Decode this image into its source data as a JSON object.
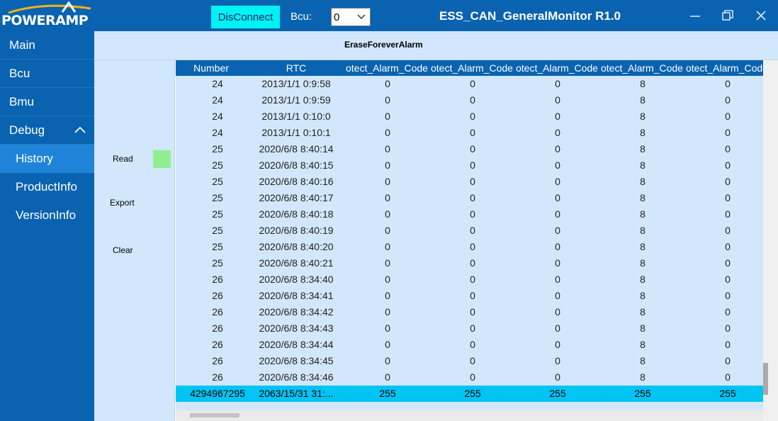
{
  "titlebar": {
    "logo": "POWERAMP",
    "disconnect_label": "DisConnect",
    "bcu_label": "Bcu:",
    "bcu_value": "0",
    "title": "ESS_CAN_GeneralMonitor R1.0"
  },
  "sidebar": {
    "items": [
      {
        "label": "Main"
      },
      {
        "label": "Bcu"
      },
      {
        "label": "Bmu"
      },
      {
        "label": "Debug"
      },
      {
        "label": "History"
      },
      {
        "label": "ProductInfo"
      },
      {
        "label": "VersionInfo"
      }
    ]
  },
  "header": {
    "erase_label": "EraseForeverAlarm"
  },
  "controls": {
    "read": "Read",
    "export": "Export",
    "clear": "Clear"
  },
  "colors": {
    "brand_blue": "#0a63b0",
    "panel": "#d2e7fb",
    "accent_cyan": "#00f2f2",
    "selected_row": "#00c4f4",
    "led_green": "#90ee90"
  },
  "table": {
    "columns": [
      "Number",
      "RTC",
      "otect_Alarm_Code",
      "otect_Alarm_Code",
      "otect_Alarm_Code",
      "otect_Alarm_Code",
      "otect_Alarm_Code"
    ],
    "rows": [
      [
        "24",
        "2013/1/1 0:9:58",
        "0",
        "0",
        "0",
        "8",
        "0"
      ],
      [
        "24",
        "2013/1/1 0:9:59",
        "0",
        "0",
        "0",
        "8",
        "0"
      ],
      [
        "24",
        "2013/1/1 0:10:0",
        "0",
        "0",
        "0",
        "8",
        "0"
      ],
      [
        "24",
        "2013/1/1 0:10:1",
        "0",
        "0",
        "0",
        "8",
        "0"
      ],
      [
        "25",
        "2020/6/8 8:40:14",
        "0",
        "0",
        "0",
        "8",
        "0"
      ],
      [
        "25",
        "2020/6/8 8:40:15",
        "0",
        "0",
        "0",
        "8",
        "0"
      ],
      [
        "25",
        "2020/6/8 8:40:16",
        "0",
        "0",
        "0",
        "8",
        "0"
      ],
      [
        "25",
        "2020/6/8 8:40:17",
        "0",
        "0",
        "0",
        "8",
        "0"
      ],
      [
        "25",
        "2020/6/8 8:40:18",
        "0",
        "0",
        "0",
        "8",
        "0"
      ],
      [
        "25",
        "2020/6/8 8:40:19",
        "0",
        "0",
        "0",
        "8",
        "0"
      ],
      [
        "25",
        "2020/6/8 8:40:20",
        "0",
        "0",
        "0",
        "8",
        "0"
      ],
      [
        "25",
        "2020/6/8 8:40:21",
        "0",
        "0",
        "0",
        "8",
        "0"
      ],
      [
        "26",
        "2020/6/8 8:34:40",
        "0",
        "0",
        "0",
        "8",
        "0"
      ],
      [
        "26",
        "2020/6/8 8:34:41",
        "0",
        "0",
        "0",
        "8",
        "0"
      ],
      [
        "26",
        "2020/6/8 8:34:42",
        "0",
        "0",
        "0",
        "8",
        "0"
      ],
      [
        "26",
        "2020/6/8 8:34:43",
        "0",
        "0",
        "0",
        "8",
        "0"
      ],
      [
        "26",
        "2020/6/8 8:34:44",
        "0",
        "0",
        "0",
        "8",
        "0"
      ],
      [
        "26",
        "2020/6/8 8:34:45",
        "0",
        "0",
        "0",
        "8",
        "0"
      ],
      [
        "26",
        "2020/6/8 8:34:46",
        "0",
        "0",
        "0",
        "8",
        "0"
      ],
      [
        "4294967295",
        "2063/15/31 31:...",
        "255",
        "255",
        "255",
        "255",
        "255"
      ]
    ],
    "selected_row": 19
  }
}
